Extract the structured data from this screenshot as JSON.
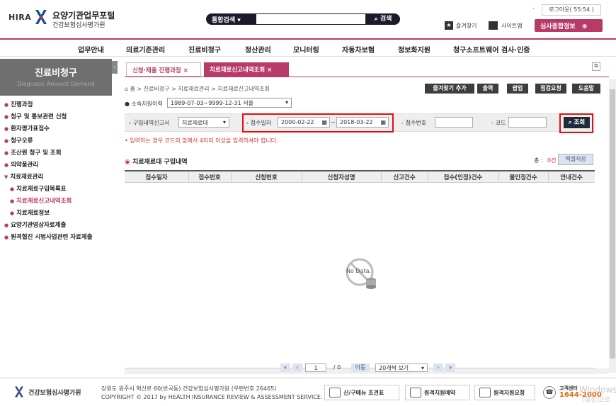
{
  "header": {
    "brand": "HIRA",
    "portal_title": "요양기관업무포털",
    "portal_sub": "건강보험심사평가원",
    "search_select": "통합검색",
    "search_button": "검색",
    "logout": "로그아웃( 55:54 )",
    "favorites": "즐겨찾기",
    "sitemap": "사이트맵",
    "exam_info": "심사종합정보"
  },
  "nav": [
    "업무안내",
    "의료기준관리",
    "진료비청구",
    "정산관리",
    "모니터링",
    "자동차보험",
    "정보화지원",
    "청구소프트웨어 검사·인증"
  ],
  "sidebar": {
    "title": "진료비청구",
    "subtitle": "Diagnosis Amount Demand",
    "items": [
      "진행과정",
      "청구 및 통보관련 신청",
      "환자평가표접수",
      "청구오류",
      "조산원 청구 및 조회",
      "의약품관리",
      "치료재료관리",
      "치료재료구입목록표",
      "치료재료신고내역조회",
      "치료재료정보",
      "요양기관영상자료제출",
      "원격협진 시범사업관련 자료제출"
    ]
  },
  "tabs": [
    "신청·제출 진행과정",
    "치료재료신고내역조회"
  ],
  "breadcrumb": "홈 > 진료비청구 > 치료재료관리 > 치료재료신고내역조회",
  "toolbar": [
    "즐겨찾기 추가",
    "출력",
    "팝업",
    "점검요청",
    "도움말"
  ],
  "org": {
    "label": "소속지원이력",
    "value": "1989-07-03~9999-12-31 서울"
  },
  "filter": {
    "type_label": "구입내역신고서",
    "type_value": "치료재료대",
    "date_label": "접수일자",
    "date_from": "2000-02-22",
    "date_sep": "~",
    "date_to": "2018-03-22",
    "receipt_label": "접수번호",
    "code_label": "코드",
    "query_button": "조회",
    "hint": "• 입력하는 경우 코드의 앞에서 4자리 이상을 입력하셔야 합니다."
  },
  "list": {
    "title": "치료재료대 구입내역",
    "total_label": "총 :",
    "total_count": "0건",
    "excel": "엑셀저장",
    "columns": [
      "접수일자",
      "접수번호",
      "신청번호",
      "신청자성명",
      "신고건수",
      "접수(인정)건수",
      "불인정건수",
      "안내건수"
    ],
    "empty": "No Data."
  },
  "pagination": {
    "page": "1",
    "total": "/ 0",
    "move": "이동",
    "page_size": "20개씩 보기"
  },
  "footer": {
    "org": "건강보험심사평가원",
    "address": "강원도 원주시 혁신로 60(반곡동) 건강보험심사평가원  (우편번호 26465)",
    "copyright": "COPYRIGHT © 2017 by HEALTH INSURANCE REVIEW & ASSESSMENT SERVICE.",
    "btn1": "신/구메뉴 조견표",
    "btn2": "원격지원예약",
    "btn3": "원격지원요청",
    "cc_label": "고객센터",
    "cc_number": "1644-2000",
    "watermark1": "Windows",
    "watermark2": "[설정]으로"
  },
  "colors": {
    "accent": "#b83a67",
    "dark": "#1e2b3a",
    "alert": "#e01010"
  }
}
